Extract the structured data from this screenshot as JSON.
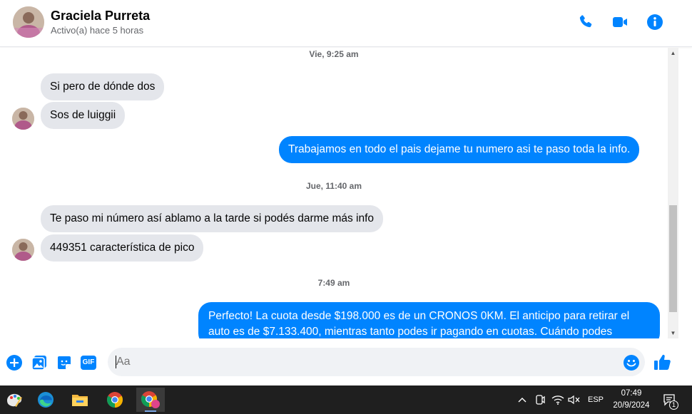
{
  "header": {
    "contact_name": "Graciela Purreta",
    "status": "Activo(a) hace 5 horas",
    "icons": [
      "phone-icon",
      "video-icon",
      "info-icon"
    ],
    "accent_color": "#0084ff"
  },
  "messages": [
    {
      "type": "timestamp",
      "text": "Vie, 9:25 am"
    },
    {
      "type": "incoming",
      "text": "Si pero de dónde dos"
    },
    {
      "type": "incoming",
      "text": "Sos de luiggii"
    },
    {
      "type": "outgoing",
      "text": "Trabajamos en todo el pais dejame tu numero asi te paso toda la info."
    },
    {
      "type": "timestamp",
      "text": "Jue, 11:40 am"
    },
    {
      "type": "incoming",
      "text": "Te paso mi número así ablamo a la tarde si podés darme más info"
    },
    {
      "type": "incoming",
      "text": "449351 característica de pico"
    },
    {
      "type": "timestamp",
      "text": "7:49 am"
    },
    {
      "type": "outgoing",
      "text": "Perfecto! La cuota desde $198.000 es de un CRONOS 0KM. El anticipo para retirar el auto es de $7.133.400, mientras tanto podes ir pagando en cuotas. Cuándo podes"
    }
  ],
  "composer": {
    "placeholder": "Aa",
    "gif_label": "GIF",
    "icons": [
      "add-icon",
      "image-icon",
      "sticker-icon",
      "gif-icon",
      "emoji-icon",
      "like-icon"
    ]
  },
  "taskbar": {
    "apps": [
      "paint-icon",
      "edge-icon",
      "file-explorer-icon",
      "chrome-icon",
      "chrome-profile-icon"
    ],
    "language": "ESP",
    "time": "07:49",
    "date": "20/9/2024",
    "notification_count": "1"
  }
}
